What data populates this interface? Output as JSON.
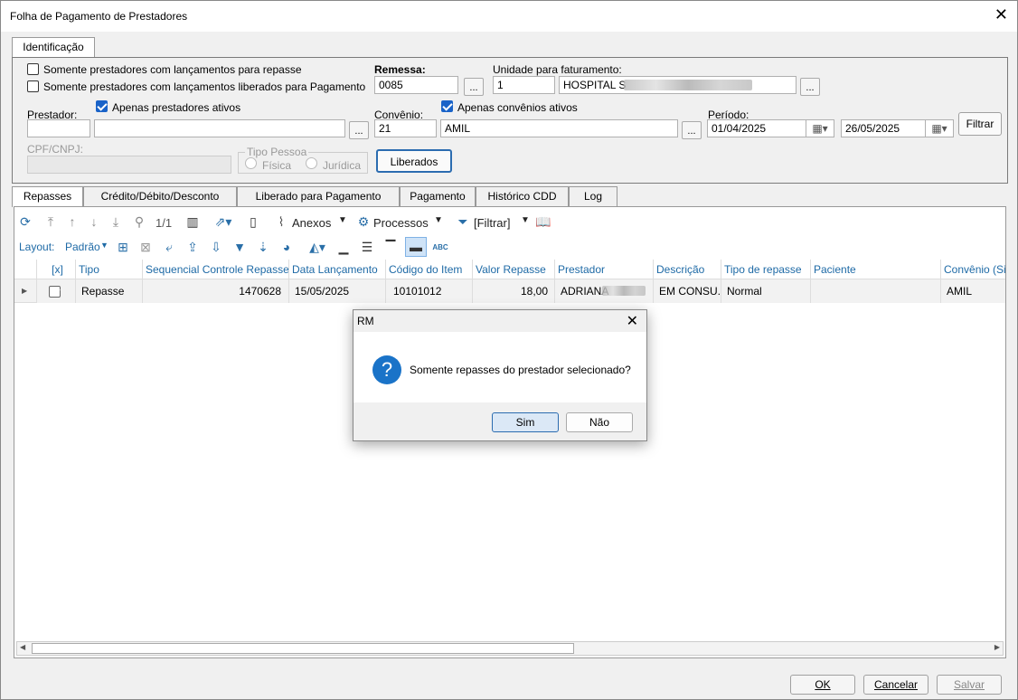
{
  "window": {
    "title": "Folha de Pagamento de Prestadores",
    "close": "✕"
  },
  "tab_ident": "Identificação",
  "filters": {
    "cb1": "Somente prestadores com lançamentos para repasse",
    "cb2": "Somente prestadores com lançamentos liberados para Pagamento",
    "remessa_label": "Remessa:",
    "remessa_value": "0085",
    "unidade_label": "Unidade para faturamento:",
    "unidade_code": "1",
    "unidade_name": "HOSPITAL S",
    "prestador_label": "Prestador:",
    "prestador_ativos": "Apenas prestadores ativos",
    "convenio_label": "Convênio:",
    "convenio_ativos": "Apenas convênios ativos",
    "convenio_code": "21",
    "convenio_name": "AMIL",
    "periodo_label": "Período:",
    "periodo_ini": "01/04/2025",
    "periodo_fim": "26/05/2025",
    "filtrar": "Filtrar",
    "cpf_label": "CPF/CNPJ:",
    "tipo_pessoa": "Tipo Pessoa",
    "fisica": "Física",
    "juridica": "Jurídica",
    "liberados": "Liberados",
    "dots": "..."
  },
  "tabs": [
    "Repasses",
    "Crédito/Débito/Desconto",
    "Liberado para Pagamento",
    "Pagamento",
    "Histórico CDD",
    "Log"
  ],
  "toolbar": {
    "pager": "1/1",
    "anexos": "Anexos",
    "processos": "Processos",
    "filtrar": "[Filtrar]",
    "layout_label": "Layout:",
    "layout_value": "Padrão"
  },
  "columns": [
    "[x]",
    "Tipo",
    "Sequencial Controle Repasse",
    "Data Lançamento",
    "Código do Item",
    "Valor Repasse",
    "Prestador",
    "Descrição",
    "Tipo de repasse",
    "Paciente",
    "Convênio (Sigl"
  ],
  "row": {
    "tipo": "Repasse",
    "seq": "1470628",
    "data": "15/05/2025",
    "codigo": "10101012",
    "valor": "18,00",
    "prestador": "ADRIANA",
    "descricao": "EM CONSU...",
    "tipo_repasse": "Normal",
    "paciente": "",
    "convenio": "AMIL"
  },
  "dialog": {
    "title": "RM",
    "message": "Somente repasses do prestador selecionado?",
    "yes": "Sim",
    "no": "Não",
    "close": "✕"
  },
  "footer": {
    "ok": "OK",
    "cancel": "Cancelar",
    "save": "Salvar"
  }
}
